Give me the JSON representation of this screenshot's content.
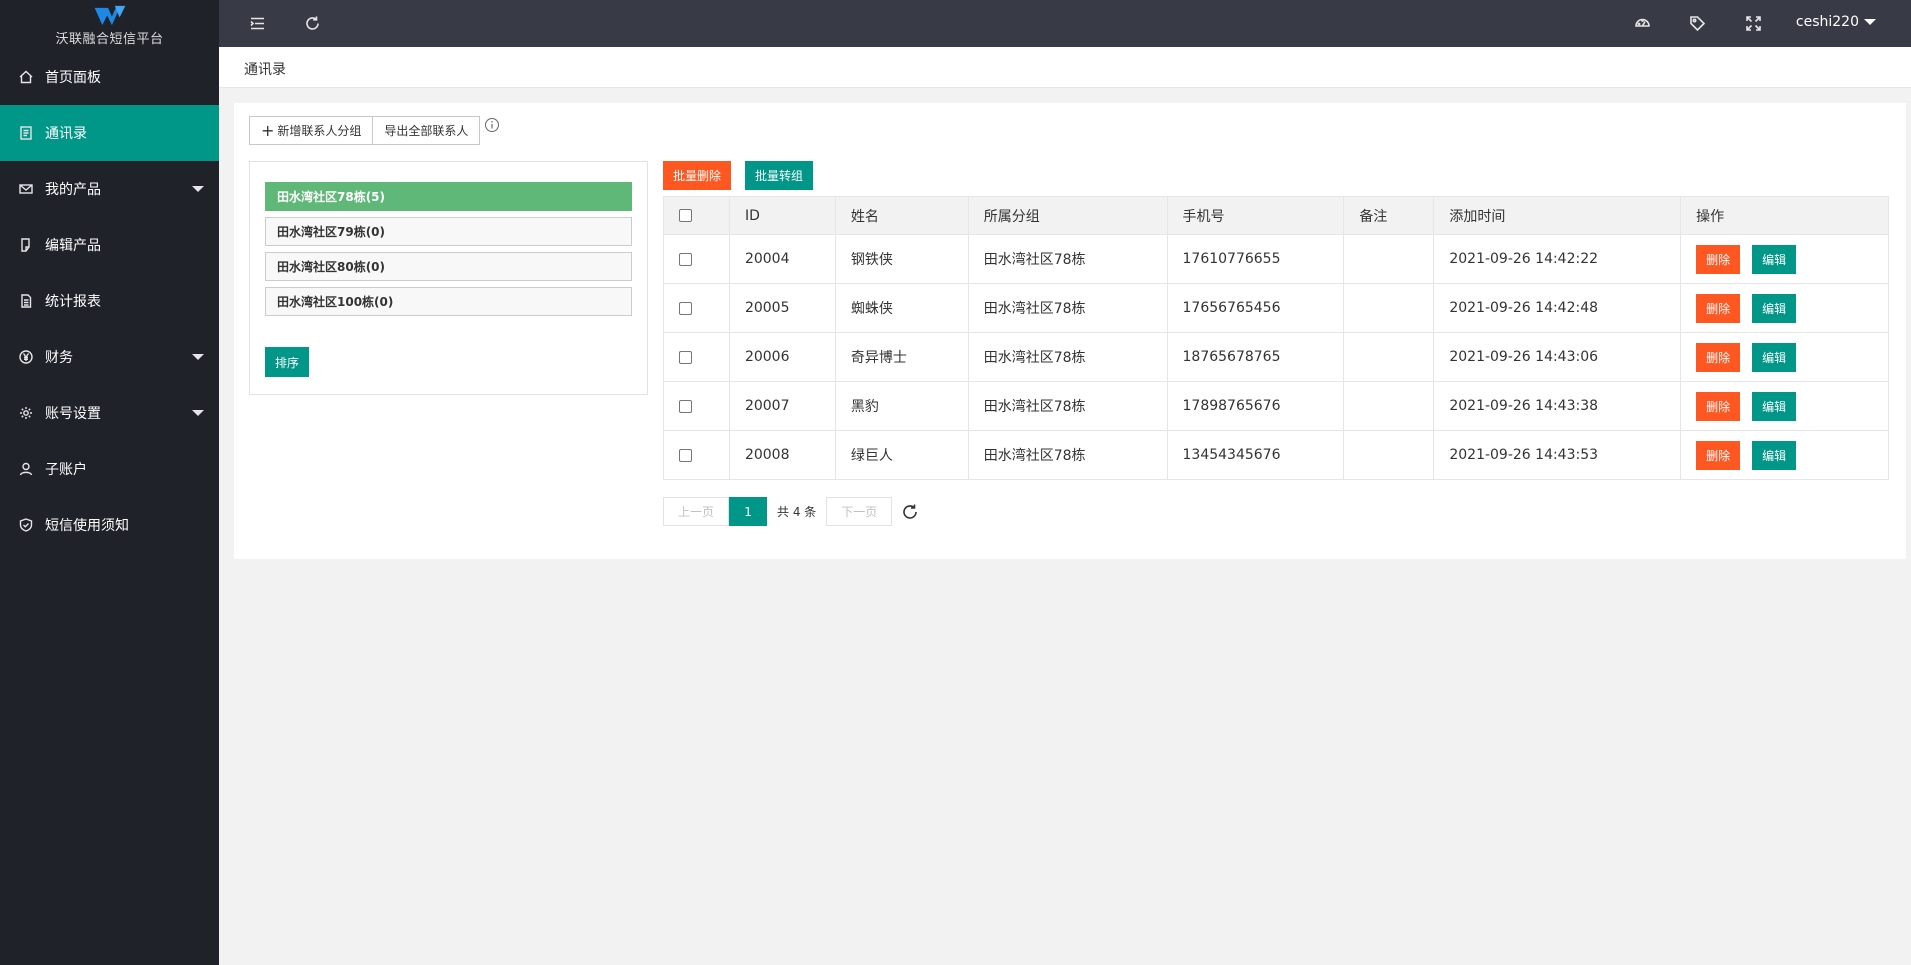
{
  "app": {
    "name": "沃联融合短信平台",
    "brand_color": "#009688"
  },
  "sidebar": {
    "items": [
      {
        "label": "首页面板",
        "icon": "home-icon"
      },
      {
        "label": "通讯录",
        "icon": "contacts-icon",
        "active": true
      },
      {
        "label": "我的产品",
        "icon": "mail-icon",
        "has_children": true
      },
      {
        "label": "编辑产品",
        "icon": "edit-doc-icon"
      },
      {
        "label": "统计报表",
        "icon": "report-icon"
      },
      {
        "label": "财务",
        "icon": "yen-icon",
        "has_children": true
      },
      {
        "label": "账号设置",
        "icon": "gear-icon",
        "has_children": true
      },
      {
        "label": "子账户",
        "icon": "user-icon"
      },
      {
        "label": "短信使用须知",
        "icon": "shield-icon"
      }
    ]
  },
  "header": {
    "icons": [
      "menu-fold-icon",
      "refresh-icon",
      "theme-icon",
      "tag-icon",
      "fullscreen-icon"
    ],
    "username": "ceshi220"
  },
  "breadcrumb": {
    "title": "通讯录"
  },
  "toolbar": {
    "add_group_label": "新增联系人分组",
    "export_label": "导出全部联系人"
  },
  "groups": {
    "items": [
      "田水湾社区78栋(5)",
      "田水湾社区79栋(0)",
      "田水湾社区80栋(0)",
      "田水湾社区100栋(0)"
    ],
    "active_index": 0,
    "sort_label": "排序"
  },
  "batch": {
    "delete_label": "批量删除",
    "move_label": "批量转组"
  },
  "table": {
    "columns": [
      "ID",
      "姓名",
      "所属分组",
      "手机号",
      "备注",
      "添加时间",
      "操作"
    ],
    "rows": [
      {
        "id": "20004",
        "name": "钢铁侠",
        "group": "田水湾社区78栋",
        "phone": "17610776655",
        "note": "",
        "time": "2021-09-26 14:42:22"
      },
      {
        "id": "20005",
        "name": "蜘蛛侠",
        "group": "田水湾社区78栋",
        "phone": "17656765456",
        "note": "",
        "time": "2021-09-26 14:42:48"
      },
      {
        "id": "20006",
        "name": "奇异博士",
        "group": "田水湾社区78栋",
        "phone": "18765678765",
        "note": "",
        "time": "2021-09-26 14:43:06"
      },
      {
        "id": "20007",
        "name": "黑豹",
        "group": "田水湾社区78栋",
        "phone": "17898765676",
        "note": "",
        "time": "2021-09-26 14:43:38"
      },
      {
        "id": "20008",
        "name": "绿巨人",
        "group": "田水湾社区78栋",
        "phone": "13454345676",
        "note": "",
        "time": "2021-09-26 14:43:53"
      }
    ],
    "delete_label": "删除",
    "edit_label": "编辑"
  },
  "pagination": {
    "prev_label": "上一页",
    "current_page": "1",
    "total_label": "共 4 条",
    "next_label": "下一页"
  }
}
